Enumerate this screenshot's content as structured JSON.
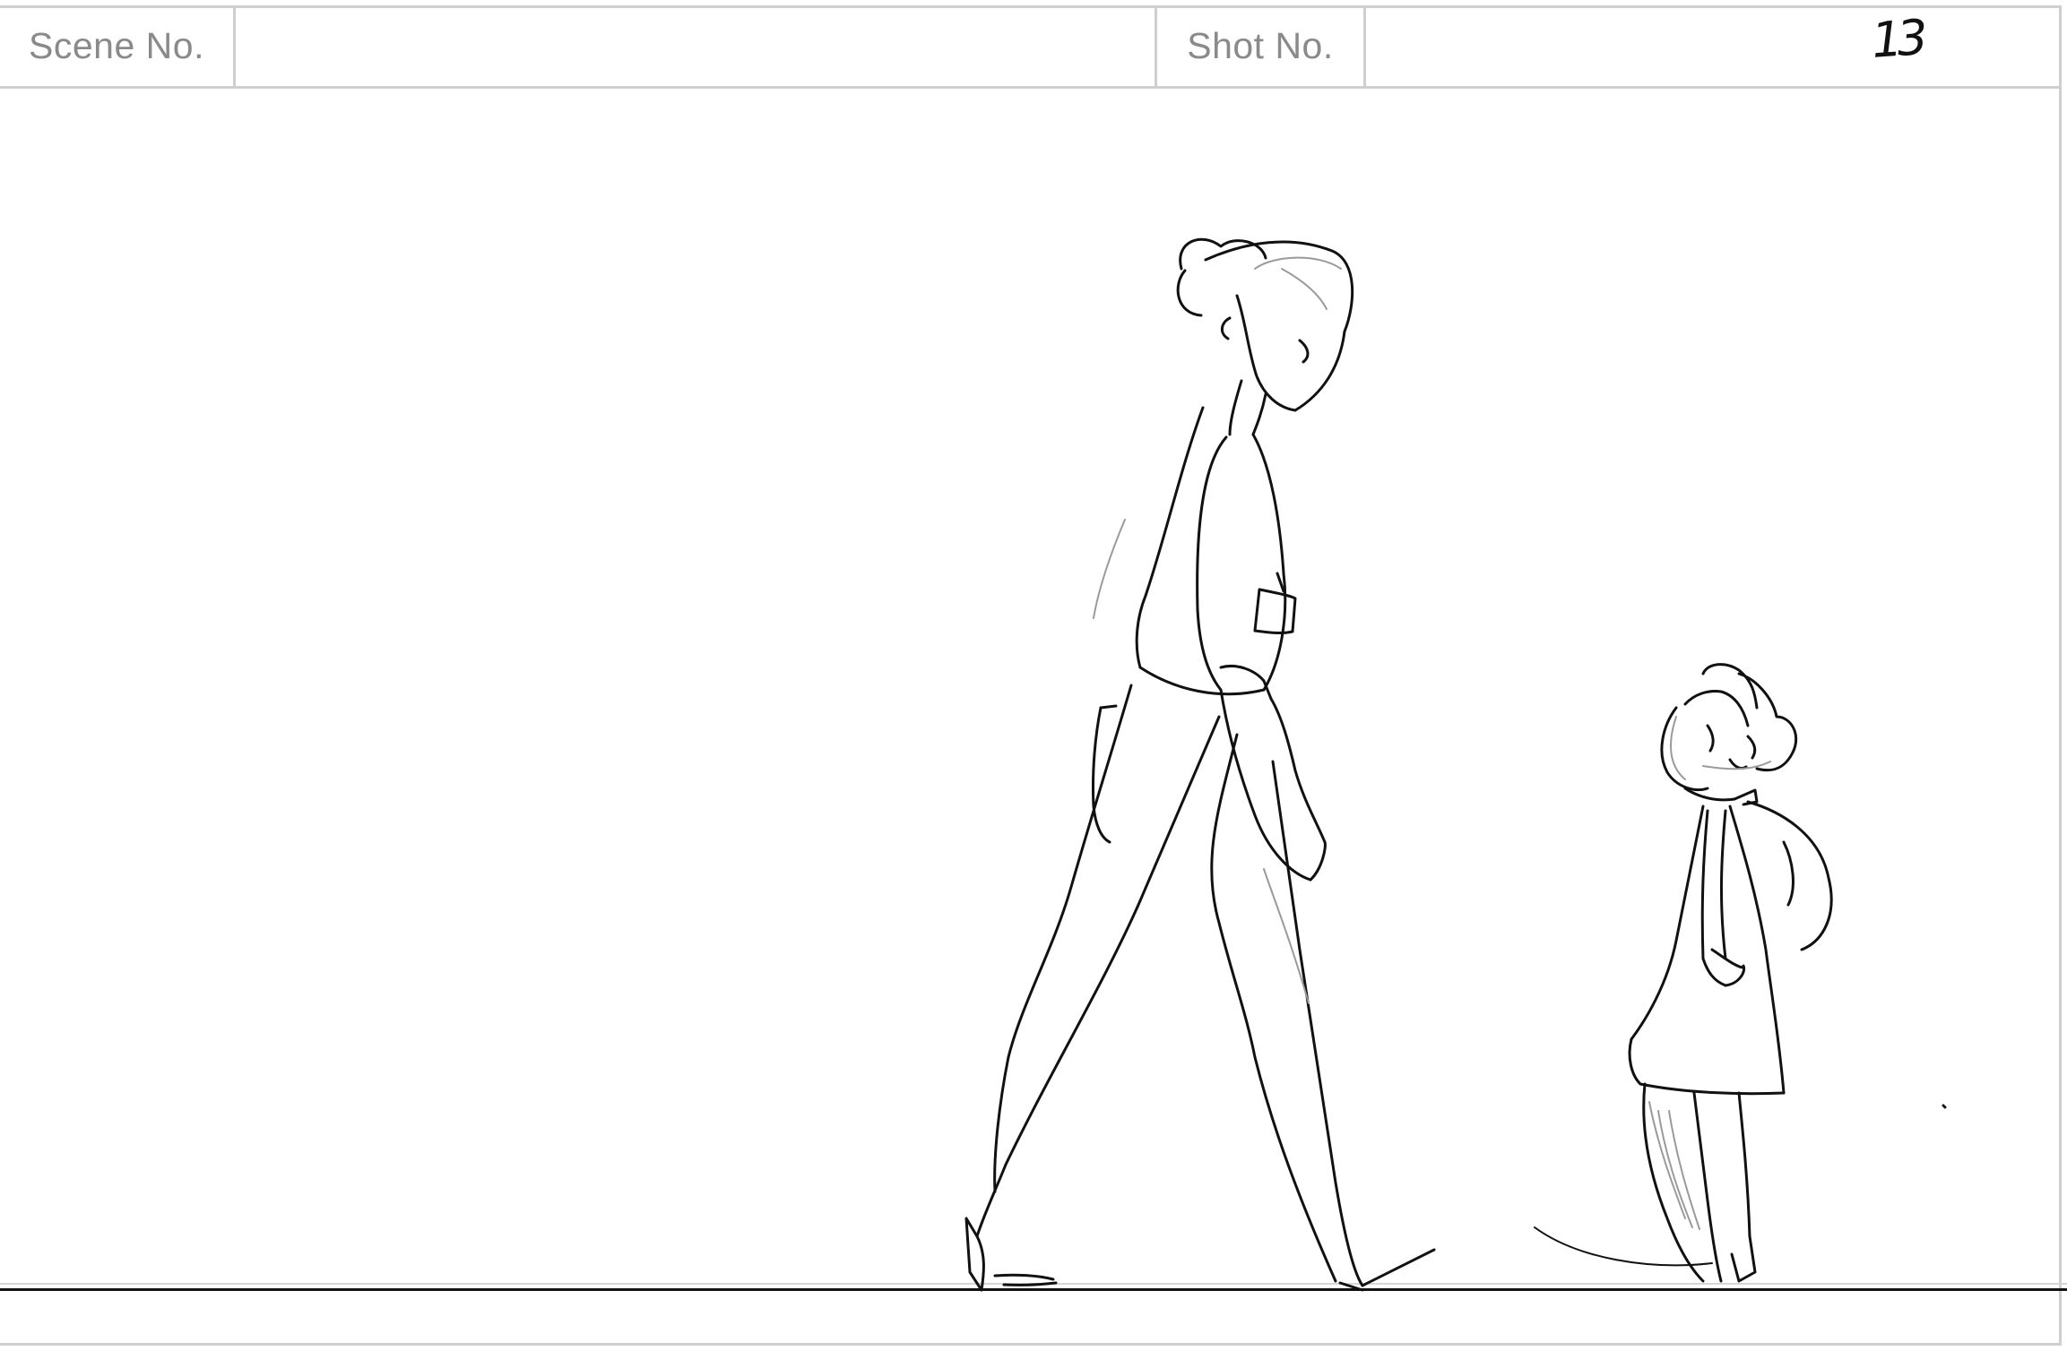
{
  "header": {
    "scene_label": "Scene No.",
    "scene_value": "",
    "shot_label": "Shot No.",
    "shot_value": "",
    "panel_number": "13"
  },
  "sketch": {
    "subject_adult": "adult-figure-walking",
    "subject_child": "child-figure-looking-up",
    "line_color": "#111111",
    "frame_color": "#cfcfcf"
  }
}
